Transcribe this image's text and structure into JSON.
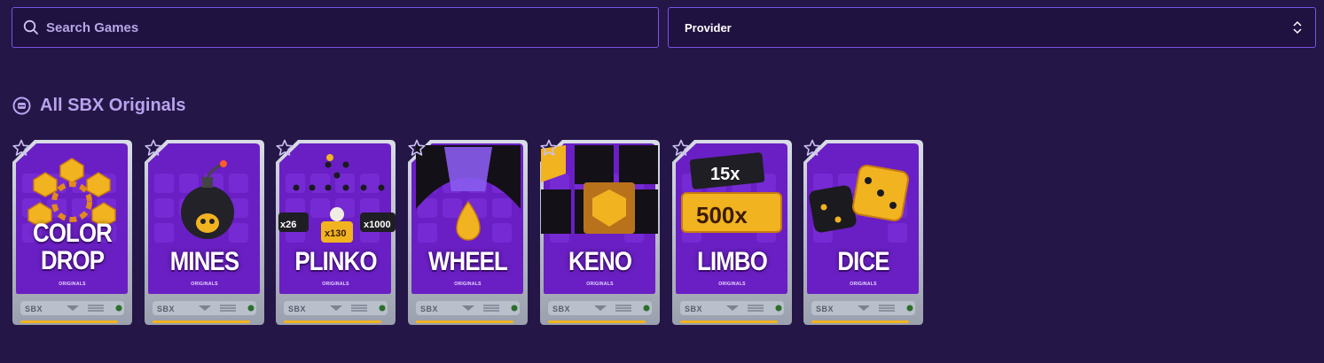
{
  "search": {
    "placeholder": "Search Games"
  },
  "provider": {
    "label": "Provider"
  },
  "section": {
    "title": "All SBX Originals"
  },
  "games": [
    {
      "title": "COLOR DROP",
      "sub": "ORIGINALS",
      "brand": "SBX"
    },
    {
      "title": "MINES",
      "sub": "ORIGINALS",
      "brand": "SBX"
    },
    {
      "title": "PLINKO",
      "sub": "ORIGINALS",
      "brand": "SBX"
    },
    {
      "title": "WHEEL",
      "sub": "ORIGINALS",
      "brand": "SBX"
    },
    {
      "title": "KENO",
      "sub": "ORIGINALS",
      "brand": "SBX"
    },
    {
      "title": "LIMBO",
      "sub": "ORIGINALS",
      "brand": "SBX"
    },
    {
      "title": "DICE",
      "sub": "ORIGINALS",
      "brand": "SBX"
    }
  ],
  "plinko_multipliers": [
    "x26",
    "x130",
    "x1000"
  ],
  "limbo_multipliers": [
    "15x",
    "500x"
  ],
  "colors": {
    "background": "#241646",
    "border": "#7a55e6",
    "card_purple": "#6a1fc4",
    "accent_gold": "#f2b321"
  }
}
